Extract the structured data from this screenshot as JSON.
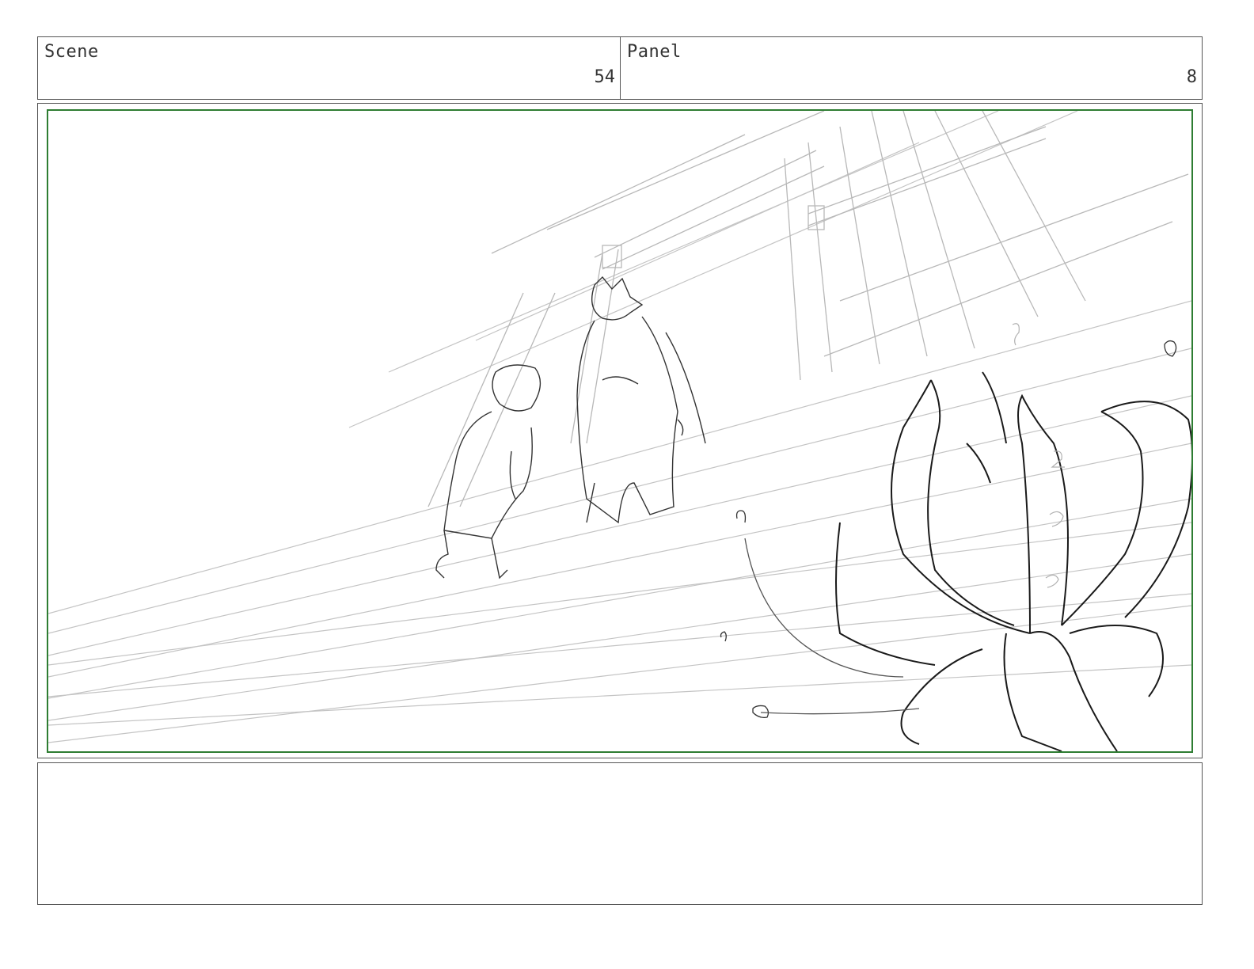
{
  "header": {
    "scene_label": "Scene",
    "scene_value": "54",
    "panel_label": "Panel",
    "panel_value": "8"
  },
  "frame": {
    "border_color": "#2e7d32",
    "content": "pencil sketch"
  },
  "notes": {
    "text": ""
  }
}
